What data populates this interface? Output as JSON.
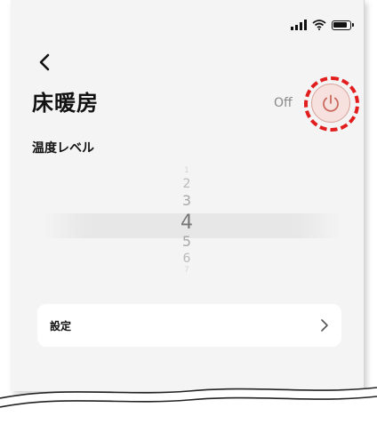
{
  "header": {
    "title": "床暖房",
    "back_icon": "chevron-left-icon"
  },
  "power": {
    "state_label": "Off",
    "icon": "power-icon",
    "highlight_color": "#e11d1d"
  },
  "temperature": {
    "label": "温度レベル",
    "levels": [
      "1",
      "2",
      "3",
      "4",
      "5",
      "6",
      "7"
    ],
    "selected": "4"
  },
  "settings": {
    "label": "設定",
    "chevron_icon": "chevron-right-icon"
  },
  "status_bar": {
    "icons": [
      "signal-icon",
      "wifi-icon",
      "battery-icon"
    ]
  }
}
